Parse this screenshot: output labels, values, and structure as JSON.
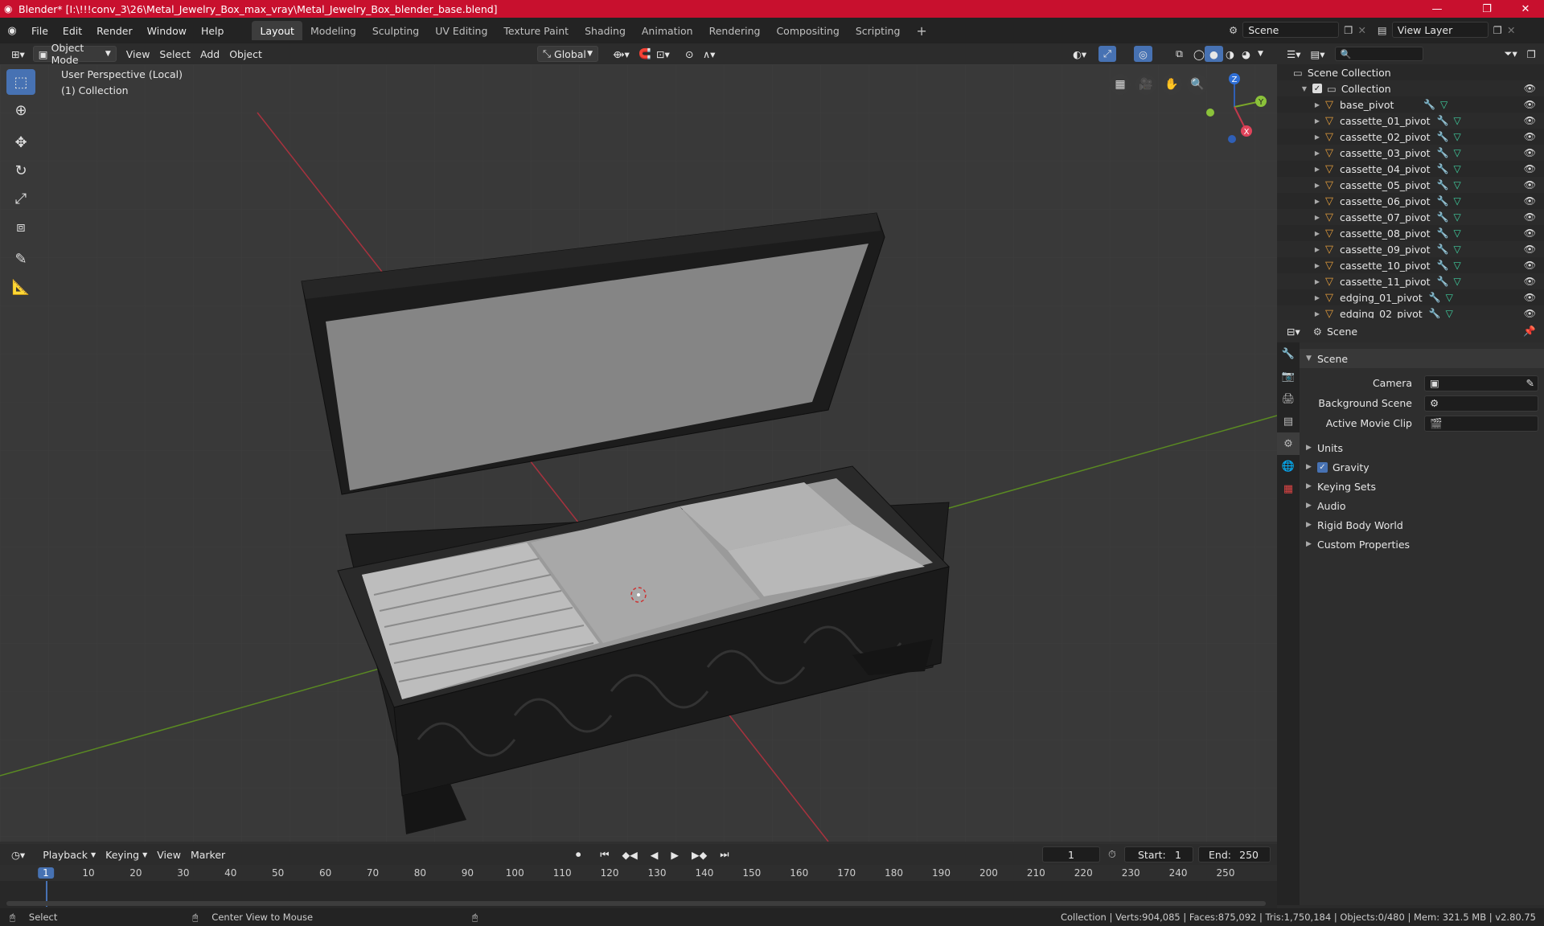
{
  "window": {
    "title": "Blender* [I:\\!!!conv_3\\26\\Metal_Jewelry_Box_max_vray\\Metal_Jewelry_Box_blender_base.blend]",
    "min": "—",
    "max": "❐",
    "close": "✕"
  },
  "menus": [
    "File",
    "Edit",
    "Render",
    "Window",
    "Help"
  ],
  "workspaces": [
    "Layout",
    "Modeling",
    "Sculpting",
    "UV Editing",
    "Texture Paint",
    "Shading",
    "Animation",
    "Rendering",
    "Compositing",
    "Scripting"
  ],
  "add_tab": "+",
  "scene_name": "Scene",
  "view_layer": "View Layer",
  "viewport_header": {
    "mode": "Object Mode",
    "menus": [
      "View",
      "Select",
      "Add",
      "Object"
    ],
    "orientation": "Global"
  },
  "viewport_info": {
    "line1": "User Perspective (Local)",
    "line2": "(1) Collection"
  },
  "gizmo": {
    "z": "Z",
    "y": "Y",
    "x": "X"
  },
  "outliner": {
    "search_placeholder": "",
    "root": "Scene Collection",
    "collection": "Collection",
    "items": [
      "base_pivot",
      "cassette_01_pivot",
      "cassette_02_pivot",
      "cassette_03_pivot",
      "cassette_04_pivot",
      "cassette_05_pivot",
      "cassette_06_pivot",
      "cassette_07_pivot",
      "cassette_08_pivot",
      "cassette_09_pivot",
      "cassette_10_pivot",
      "cassette_11_pivot",
      "edging_01_pivot",
      "edging_02_pivot"
    ]
  },
  "properties": {
    "context": "Scene",
    "panel": "Scene",
    "rows": [
      {
        "label": "Camera",
        "value": ""
      },
      {
        "label": "Background Scene",
        "value": ""
      },
      {
        "label": "Active Movie Clip",
        "value": ""
      }
    ],
    "sections": [
      "Units",
      "Gravity",
      "Keying Sets",
      "Audio",
      "Rigid Body World",
      "Custom Properties"
    ],
    "gravity_checked": true
  },
  "timeline": {
    "menus": [
      "Playback",
      "Keying",
      "View",
      "Marker"
    ],
    "current_frame": "1",
    "start_label": "Start:",
    "start": "1",
    "end_label": "End:",
    "end": "250",
    "ticks": [
      "1",
      "10",
      "20",
      "30",
      "40",
      "50",
      "60",
      "70",
      "80",
      "90",
      "100",
      "110",
      "120",
      "130",
      "140",
      "150",
      "160",
      "170",
      "180",
      "190",
      "200",
      "210",
      "220",
      "230",
      "240",
      "250"
    ]
  },
  "statusbar": {
    "left": "Select",
    "middle": "Center View to Mouse",
    "right": "Collection | Verts:904,085 | Faces:875,092 | Tris:1,750,184 | Objects:0/480 | Mem: 321.5 MB | v2.80.75"
  }
}
